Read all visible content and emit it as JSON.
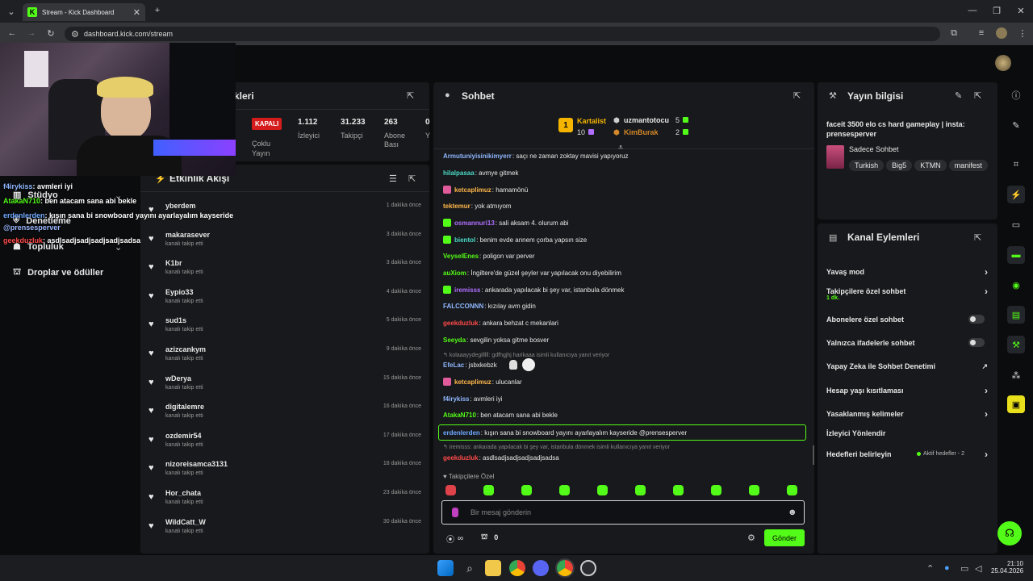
{
  "browser": {
    "tab_title": "Stream - Kick Dashboard",
    "url": "dashboard.kick.com/stream",
    "new_tab": "+"
  },
  "nav": {
    "items": [
      {
        "label": "Stüdyo"
      },
      {
        "label": "Denetleme"
      },
      {
        "label": "Topluluk"
      },
      {
        "label": "Droplar ve ödüller"
      }
    ]
  },
  "overlay_chat": [
    {
      "user": "f4irykiss",
      "text": ": avmleri iyi",
      "color": "#8fb7ff"
    },
    {
      "user": "AtakaN710",
      "text": ": ben atacam sana abi bekle",
      "color": "#53fc18"
    },
    {
      "user": "erdenlerden",
      "text": ": kışın sana bi snowboard yayını ayarlayalım kayseride",
      "color": "#6fa8ff"
    },
    {
      "user": "",
      "text": "@prensesperver",
      "color": "#9bb8ff"
    },
    {
      "user": "geekduzluk",
      "text": ": asdlsadjsadjsadjsadjsadsa",
      "color": "#ff4a4a"
    }
  ],
  "stream_panel": {
    "title_tail": "kleri",
    "status": "KAPALI",
    "status_label": "Çoklu Yayın",
    "stats": [
      {
        "value": "1.112",
        "label": "İzleyici"
      },
      {
        "value": "31.233",
        "label": "Takipçi"
      },
      {
        "value": "263",
        "label": "Abone Bası"
      },
      {
        "value": "0",
        "label": "Y"
      }
    ]
  },
  "activity": {
    "title": "Etkinlik Akışı",
    "items": [
      {
        "name": "yberdem",
        "sub": "",
        "time": "1 dakika önce"
      },
      {
        "name": "makarasever",
        "sub": "kanalı takip etti",
        "time": "3 dakika önce"
      },
      {
        "name": "K1br",
        "sub": "kanalı takip etti",
        "time": "3 dakika önce"
      },
      {
        "name": "Eypio33",
        "sub": "kanalı takip etti",
        "time": "4 dakika önce"
      },
      {
        "name": "sud1s",
        "sub": "kanalı takip etti",
        "time": "5 dakika önce"
      },
      {
        "name": "azizcankym",
        "sub": "kanalı takip etti",
        "time": "9 dakika önce"
      },
      {
        "name": "wDerya",
        "sub": "kanalı takip etti",
        "time": "15 dakika önce"
      },
      {
        "name": "digitalemre",
        "sub": "kanalı takip etti",
        "time": "16 dakika önce"
      },
      {
        "name": "ozdemir54",
        "sub": "kanalı takip etti",
        "time": "17 dakika önce"
      },
      {
        "name": "nizoreisamca3131",
        "sub": "kanalı takip etti",
        "time": "18 dakika önce"
      },
      {
        "name": "Hor_chata",
        "sub": "kanalı takip etti",
        "time": "23 dakika önce"
      },
      {
        "name": "WildCatt_W",
        "sub": "kanalı takip etti",
        "time": "30 dakika önce"
      }
    ]
  },
  "chat": {
    "title": "Sohbet",
    "leaders": [
      {
        "name": "Kartalist",
        "count": "10",
        "rank": "1"
      },
      {
        "name": "uzmantotocu",
        "count": "5"
      },
      {
        "name": "KimBurak",
        "count": "2"
      }
    ],
    "messages": [
      {
        "user": "Armutuniyisinikimyerr",
        "text": ": saçı ne zaman zoktay mavisi yapıyoruz",
        "color": "#8fb7ff",
        "badge": ""
      },
      {
        "user": "hilalpasaa",
        "text": ": avmye gitmek",
        "color": "#4adbc8",
        "badge": ""
      },
      {
        "user": "ketcaplimuz",
        "text": ": hamamönü",
        "color": "#ffb84a",
        "badge": "#e05a9c"
      },
      {
        "user": "tektemur",
        "text": ": yok atmıyom",
        "color": "#ffb84a",
        "badge": ""
      },
      {
        "user": "osmannuri13",
        "text": ": sali aksam 4. olurum abi",
        "color": "#b06fff",
        "badge": "#53fc18"
      },
      {
        "user": "bientol",
        "text": ": benim evde annem çorba yapsın size",
        "color": "#4adbc8",
        "badge": "#53fc18"
      },
      {
        "user": "VeyselEnes",
        "text": ": poligon var perver",
        "color": "#53fc18",
        "badge": ""
      },
      {
        "user": "auXiom",
        "text": ": İngiltere'de güzel şeyler var yapılacak onu diyebilirim",
        "color": "#53fc18",
        "badge": ""
      },
      {
        "user": "iremisss",
        "text": ": ankarada yapılacak bi şey var, istanbula dönmek",
        "color": "#b06fff",
        "badge": "#53fc18"
      },
      {
        "user": "FALCCONNN",
        "text": ": kızılay avm gidin",
        "color": "#8fb7ff",
        "badge": ""
      },
      {
        "user": "geekduzluk",
        "text": ": ankara behzat c mekanlari",
        "color": "#ff4a4a",
        "badge": ""
      },
      {
        "user": "Seeyda",
        "text": ": sevgilin yoksa gitme bosver",
        "color": "#53fc18",
        "badge": ""
      },
      {
        "user": "EfeLac",
        "text": ": jsbxkebzk",
        "color": "#8fb7ff",
        "badge": ""
      },
      {
        "user": "ketcaplimuz",
        "text": ": ulucanlar",
        "color": "#ffb84a",
        "badge": "#e05a9c"
      },
      {
        "user": "f4irykiss",
        "text": ": avmleri iyi",
        "color": "#8fb7ff",
        "badge": ""
      },
      {
        "user": "AtakaN710",
        "text": ": ben atacam sana abi bekle",
        "color": "#53fc18",
        "badge": ""
      },
      {
        "user": "erdenlerden",
        "text": ": kışın sana bi snowboard yayını ayarlayalım kayseride @prensesperver",
        "color": "#6fa8ff",
        "badge": ""
      },
      {
        "user": "geekduzluk",
        "text": ": asdlsadjsadjsadjsadjsadsa",
        "color": "#ff4a4a",
        "badge": ""
      }
    ],
    "reply1": "kolaaayydegilllll: gdfhgjhj harikaaa isimli kullanıcıya yanıt veriyor",
    "reply2": "iremisss: ankarada yapılacak bi şey var, istanbula dönmek isimli kullanıcıya yanıt veriyor",
    "followers_only": "Takipçilere Özel",
    "input_placeholder": "Bir mesaj gönderin",
    "points": "∞",
    "gifts": "0",
    "send": "Gönder"
  },
  "info": {
    "title": "Yayın bilgisi",
    "stream_title": "faceit 3500 elo cs hard gameplay | insta: prensesperver",
    "category": "Sadece Sohbet",
    "tags": [
      "Turkish",
      "Big5",
      "KTMN",
      "manifest"
    ]
  },
  "channel": {
    "title": "Kanal Eylemleri",
    "items": [
      {
        "label": "Yavaş mod",
        "type": "chevron",
        "sub": ""
      },
      {
        "label": "Takipçilere özel sohbet",
        "type": "chevron",
        "sub": "1 dk."
      },
      {
        "label": "Abonelere özel sohbet",
        "type": "toggle",
        "sub": ""
      },
      {
        "label": "Yalnızca ifadelerle sohbet",
        "type": "toggle",
        "sub": ""
      },
      {
        "label": "Yapay Zeka ile Sohbet Denetimi",
        "type": "ext",
        "sub": ""
      },
      {
        "label": "Hesap yaşı kısıtlaması",
        "type": "chevron",
        "sub": ""
      },
      {
        "label": "Yasaklanmış kelimeler",
        "type": "chevron",
        "sub": ""
      },
      {
        "label": "İzleyici Yönlendir",
        "type": "none",
        "sub": ""
      },
      {
        "label": "Hedefleri belirleyin",
        "type": "chevron",
        "sub": ""
      }
    ],
    "goals_status": "Aktif hedefler - 2"
  },
  "taskbar": {
    "time": "21:10",
    "date": "25.04.2026"
  },
  "colors": {
    "accent": "#53fc18",
    "panel": "#18191c",
    "bg": "#0b0c0e"
  }
}
